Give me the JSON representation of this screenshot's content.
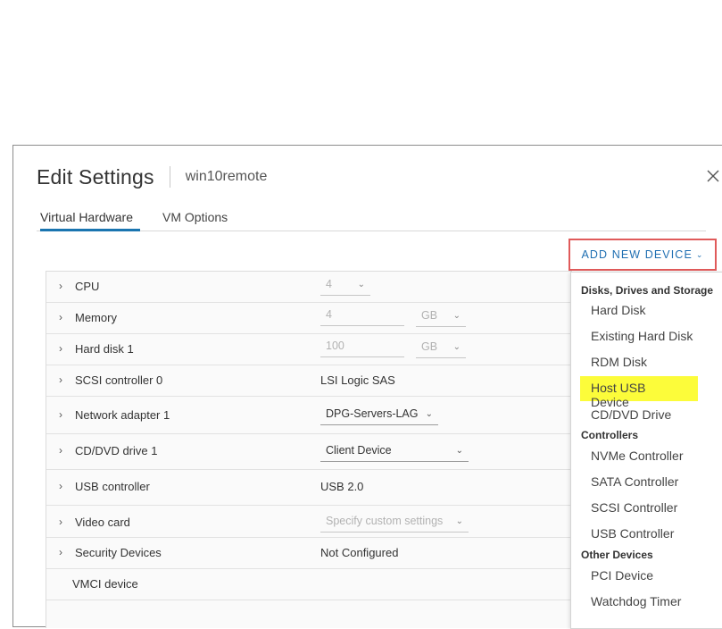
{
  "dialog": {
    "title": "Edit Settings",
    "vm_name": "win10remote",
    "close_glyph": "×",
    "tabs": [
      {
        "label": "Virtual Hardware",
        "active": true
      },
      {
        "label": "VM Options",
        "active": false
      }
    ],
    "add_device_label": "ADD NEW DEVICE",
    "add_device_caret": "⌄"
  },
  "hardware": {
    "cpu": {
      "label": "CPU",
      "value": "4"
    },
    "memory": {
      "label": "Memory",
      "value": "4",
      "unit": "GB"
    },
    "hard_disk": {
      "label": "Hard disk 1",
      "value": "100",
      "unit": "GB"
    },
    "scsi": {
      "label": "SCSI controller 0",
      "value": "LSI Logic SAS"
    },
    "network": {
      "label": "Network adapter 1",
      "value": "DPG-Servers-LAG"
    },
    "cddvd": {
      "label": "CD/DVD drive 1",
      "value": "Client Device"
    },
    "usb": {
      "label": "USB controller",
      "value": "USB 2.0"
    },
    "video": {
      "label": "Video card",
      "value": "Specify custom settings"
    },
    "security": {
      "label": "Security Devices",
      "value": "Not Configured"
    },
    "vmci": {
      "label": "VMCI device"
    }
  },
  "menu": {
    "groups": {
      "disks": "Disks, Drives and Storage",
      "controllers": "Controllers",
      "other": "Other Devices"
    },
    "items": {
      "hard_disk": "Hard Disk",
      "existing_hard_disk": "Existing Hard Disk",
      "rdm_disk": "RDM Disk",
      "host_usb": "Host USB Device",
      "cd_dvd": "CD/DVD Drive",
      "nvme": "NVMe Controller",
      "sata": "SATA Controller",
      "scsi": "SCSI Controller",
      "usb": "USB Controller",
      "pci": "PCI Device",
      "watchdog": "Watchdog Timer"
    },
    "highlight_color": "#fcfc3a"
  },
  "colors": {
    "accent": "#1a75b0",
    "callout_border": "#e05a5a"
  },
  "icons": {
    "expander": "›",
    "chevron": "⌄"
  }
}
